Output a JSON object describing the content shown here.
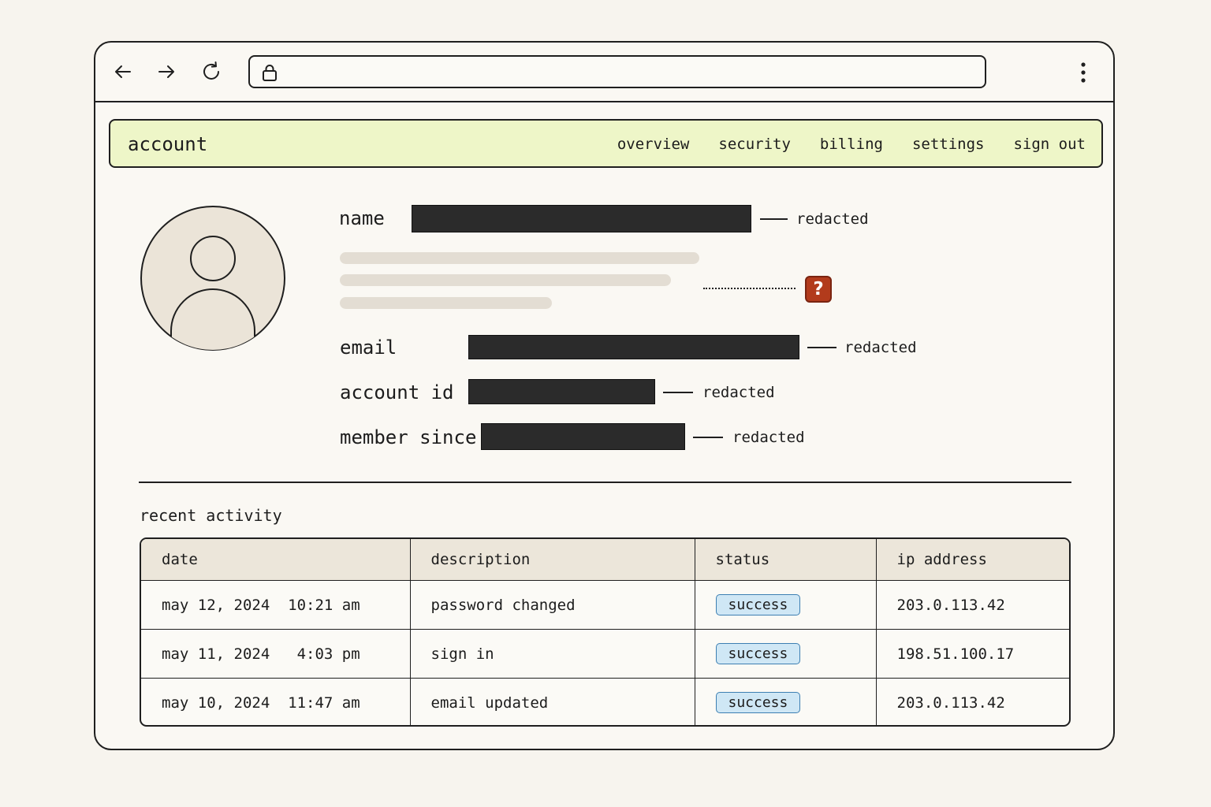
{
  "browser": {
    "url": "",
    "icons": [
      "back-arrow-icon",
      "forward-arrow-icon",
      "reload-icon",
      "lock-icon",
      "more-vertical-icon"
    ]
  },
  "app_nav": {
    "title": "account",
    "links": [
      "overview",
      "security",
      "billing",
      "settings",
      "sign out"
    ]
  },
  "profile": {
    "fields": [
      {
        "label": "name",
        "value": "[redacted]",
        "note": "redacted"
      },
      {
        "label": "email",
        "value": "[redacted]",
        "note": "redacted"
      },
      {
        "label": "account id",
        "value": "[redacted]",
        "note": "redacted"
      },
      {
        "label": "member since",
        "value": "[redacted]",
        "note": "redacted"
      }
    ],
    "unknown_marker": "?"
  },
  "activity": {
    "title": "recent activity",
    "columns": [
      "date",
      "description",
      "status",
      "ip address"
    ],
    "rows": [
      {
        "date": "may 12, 2024  10:21 am",
        "description": "password changed",
        "status": "success",
        "ip": "203.0.113.42"
      },
      {
        "date": "may 11, 2024   4:03 pm",
        "description": "sign in",
        "status": "success",
        "ip": "198.51.100.17"
      },
      {
        "date": "may 10, 2024  11:47 am",
        "description": "email updated",
        "status": "success",
        "ip": "203.0.113.42"
      }
    ]
  },
  "colors": {
    "nav_background": "#eef6c8",
    "redaction": "#2b2b2b",
    "warning": "#b23b1c",
    "success_badge": "#cfe7f5",
    "table_header": "#ece6da"
  }
}
